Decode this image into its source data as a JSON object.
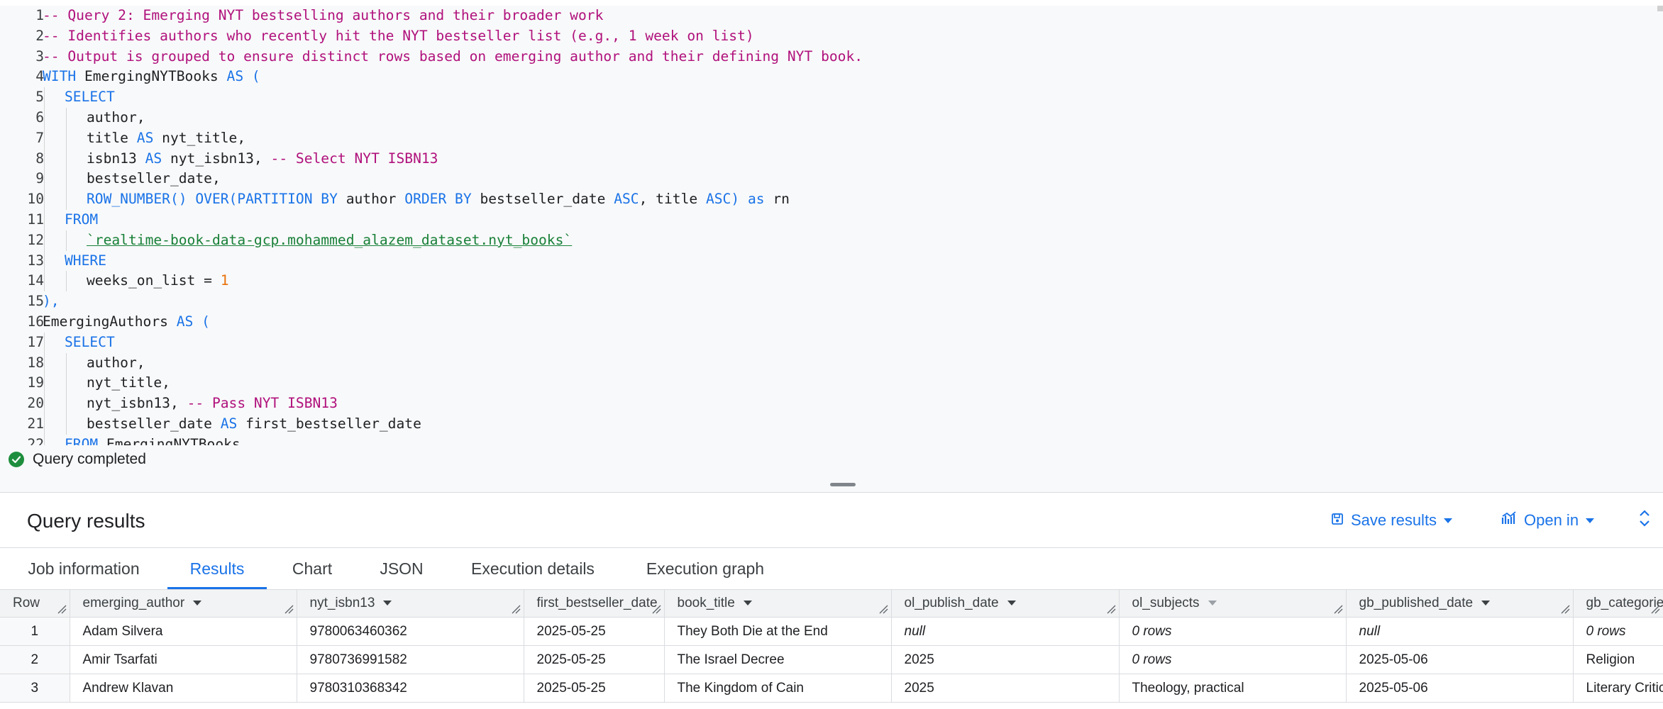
{
  "editor": {
    "lines": [
      {
        "n": "1",
        "tokens": [
          [
            "comment",
            "-- Query 2: Emerging NYT bestselling authors and their broader work"
          ]
        ]
      },
      {
        "n": "2",
        "tokens": [
          [
            "comment",
            "-- Identifies authors who recently hit the NYT bestseller list (e.g., 1 week on list)"
          ]
        ]
      },
      {
        "n": "3",
        "tokens": [
          [
            "comment",
            "-- Output is grouped to ensure distinct rows based on emerging author and their defining NYT book."
          ]
        ]
      },
      {
        "n": "4",
        "tokens": [
          [
            "keyword",
            "WITH "
          ],
          [
            "ident",
            "EmergingNYTBooks "
          ],
          [
            "keyword",
            "AS "
          ],
          [
            "punct",
            "("
          ]
        ]
      },
      {
        "n": "5",
        "indent": 1,
        "tokens": [
          [
            "keyword",
            "SELECT"
          ]
        ]
      },
      {
        "n": "6",
        "indent": 2,
        "tokens": [
          [
            "ident",
            "author,"
          ]
        ]
      },
      {
        "n": "7",
        "indent": 2,
        "tokens": [
          [
            "ident",
            "title "
          ],
          [
            "keyword",
            "AS "
          ],
          [
            "ident",
            "nyt_title,"
          ]
        ]
      },
      {
        "n": "8",
        "indent": 2,
        "tokens": [
          [
            "ident",
            "isbn13 "
          ],
          [
            "keyword",
            "AS "
          ],
          [
            "ident",
            "nyt_isbn13, "
          ],
          [
            "comment",
            "-- Select NYT ISBN13"
          ]
        ]
      },
      {
        "n": "9",
        "indent": 2,
        "tokens": [
          [
            "ident",
            "bestseller_date,"
          ]
        ]
      },
      {
        "n": "10",
        "indent": 2,
        "tokens": [
          [
            "keyword",
            "ROW_NUMBER() OVER(PARTITION BY "
          ],
          [
            "ident",
            "author "
          ],
          [
            "keyword",
            "ORDER BY "
          ],
          [
            "ident",
            "bestseller_date "
          ],
          [
            "keyword",
            "ASC"
          ],
          [
            "ident",
            ", title "
          ],
          [
            "keyword",
            "ASC) as "
          ],
          [
            "ident",
            "rn"
          ]
        ]
      },
      {
        "n": "11",
        "indent": 1,
        "tokens": [
          [
            "keyword",
            "FROM"
          ]
        ]
      },
      {
        "n": "12",
        "indent": 2,
        "tokens": [
          [
            "string",
            "`realtime-book-data-gcp.mohammed_alazem_dataset.nyt_books`"
          ]
        ]
      },
      {
        "n": "13",
        "indent": 1,
        "tokens": [
          [
            "keyword",
            "WHERE"
          ]
        ]
      },
      {
        "n": "14",
        "indent": 2,
        "tokens": [
          [
            "ident",
            "weeks_on_list = "
          ],
          [
            "number",
            "1"
          ]
        ]
      },
      {
        "n": "15",
        "tokens": [
          [
            "punct",
            "),"
          ]
        ]
      },
      {
        "n": "16",
        "tokens": [
          [
            "ident",
            "EmergingAuthors "
          ],
          [
            "keyword",
            "AS "
          ],
          [
            "punct",
            "("
          ]
        ]
      },
      {
        "n": "17",
        "indent": 1,
        "tokens": [
          [
            "keyword",
            "SELECT"
          ]
        ]
      },
      {
        "n": "18",
        "indent": 2,
        "tokens": [
          [
            "ident",
            "author,"
          ]
        ]
      },
      {
        "n": "19",
        "indent": 2,
        "tokens": [
          [
            "ident",
            "nyt_title,"
          ]
        ]
      },
      {
        "n": "20",
        "indent": 2,
        "tokens": [
          [
            "ident",
            "nyt_isbn13, "
          ],
          [
            "comment",
            "-- Pass NYT ISBN13"
          ]
        ]
      },
      {
        "n": "21",
        "indent": 2,
        "tokens": [
          [
            "ident",
            "bestseller_date "
          ],
          [
            "keyword",
            "AS "
          ],
          [
            "ident",
            "first_bestseller_date"
          ]
        ]
      },
      {
        "n": "22",
        "indent": 1,
        "tokens": [
          [
            "keyword",
            "FROM "
          ],
          [
            "ident",
            "EmergingNYTBooks"
          ]
        ]
      }
    ]
  },
  "status": {
    "icon": "check-circle-icon",
    "text": "Query completed",
    "color": "#1e8e3e"
  },
  "results": {
    "title": "Query results",
    "save_label": "Save results",
    "save_icon": "save-icon",
    "open_label": "Open in",
    "open_icon": "chart-icon",
    "expand_icon": "expand-icon"
  },
  "tabs": [
    {
      "label": "Job information",
      "active": false
    },
    {
      "label": "Results",
      "active": true
    },
    {
      "label": "Chart",
      "active": false
    },
    {
      "label": "JSON",
      "active": false
    },
    {
      "label": "Execution details",
      "active": false
    },
    {
      "label": "Execution graph",
      "active": false
    }
  ],
  "table": {
    "columns": [
      {
        "label": "Row",
        "sort": false
      },
      {
        "label": "emerging_author",
        "sort": true
      },
      {
        "label": "nyt_isbn13",
        "sort": true
      },
      {
        "label": "first_bestseller_date",
        "sort": false
      },
      {
        "label": "book_title",
        "sort": true
      },
      {
        "label": "ol_publish_date",
        "sort": true
      },
      {
        "label": "ol_subjects",
        "sort": true,
        "dim": true
      },
      {
        "label": "gb_published_date",
        "sort": true
      },
      {
        "label": "gb_categories",
        "sort": false
      }
    ],
    "rows": [
      [
        "1",
        "Adam Silvera",
        "9780063460362",
        "2025-05-25",
        "They Both Die at the End",
        "null",
        "0 rows",
        "null",
        "0 rows"
      ],
      [
        "2",
        "Amir Tsarfati",
        "9780736991582",
        "2025-05-25",
        "The Israel Decree",
        "2025",
        "0 rows",
        "2025-05-06",
        "Religion"
      ],
      [
        "3",
        "Andrew Klavan",
        "9780310368342",
        "2025-05-25",
        "The Kingdom of Cain",
        "2025",
        "Theology, practical",
        "2025-05-06",
        "Literary Criticism"
      ]
    ]
  },
  "colors": {
    "accent": "#1a73e8",
    "comment": "#b0117c",
    "string": "#188038",
    "number": "#e8710a"
  }
}
